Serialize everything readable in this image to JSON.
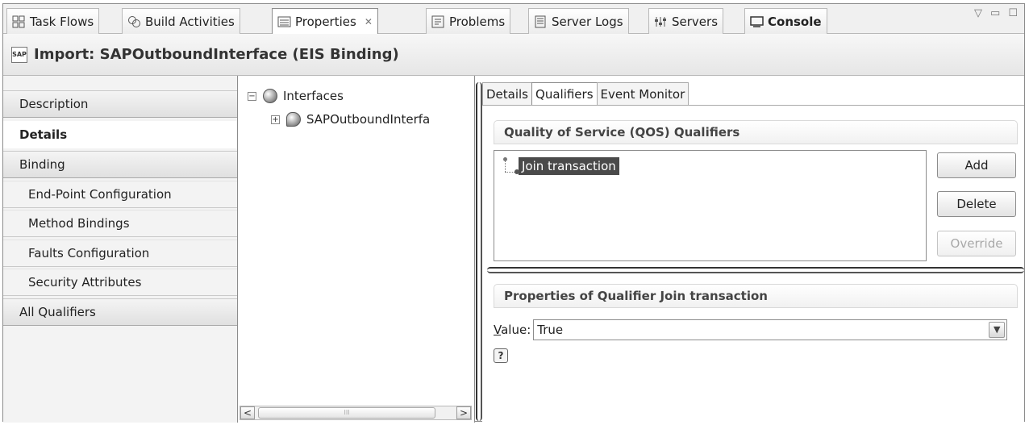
{
  "tabs": [
    {
      "label": "Task Flows",
      "icon": "task-flows-icon"
    },
    {
      "label": "Build Activities",
      "icon": "build-activities-icon"
    },
    {
      "label": "Properties",
      "icon": "properties-icon",
      "active": true,
      "close": "✕"
    },
    {
      "label": "Problems",
      "icon": "problems-icon"
    },
    {
      "label": "Server Logs",
      "icon": "server-logs-icon"
    },
    {
      "label": "Servers",
      "icon": "servers-icon"
    },
    {
      "label": "Console",
      "icon": "console-icon"
    }
  ],
  "header": {
    "icon_text": "SAP",
    "title": "Import: SAPOutboundInterface (EIS Binding)"
  },
  "nav": {
    "items": [
      {
        "label": "Description"
      },
      {
        "label": "Details",
        "selected": true
      },
      {
        "label": "Binding"
      },
      {
        "label": "End-Point Configuration",
        "sub": true
      },
      {
        "label": "Method Bindings",
        "sub": true
      },
      {
        "label": "Faults Configuration",
        "sub": true
      },
      {
        "label": "Security Attributes",
        "sub": true
      },
      {
        "label": "All Qualifiers"
      }
    ]
  },
  "tree": {
    "root": {
      "label": "Interfaces",
      "expander": "−"
    },
    "child": {
      "label": "SAPOutboundInterfa",
      "expander": "+"
    },
    "scroll_left": "<",
    "scroll_right": ">",
    "scroll_grip": "III"
  },
  "subtabs": [
    "Details",
    "Qualifiers",
    "Event Monitor"
  ],
  "qos": {
    "title": "Quality of Service (QOS) Qualifiers",
    "items": [
      "Join transaction"
    ],
    "buttons": {
      "add": "Add",
      "delete": "Delete",
      "override": "Override"
    }
  },
  "props": {
    "title": "Properties of Qualifier Join transaction",
    "value_label_access": "V",
    "value_label_rest": "alue:",
    "value": "True",
    "help": "?"
  },
  "colors": {
    "selection": "#4a4a4a",
    "border": "#8c8c8c"
  }
}
